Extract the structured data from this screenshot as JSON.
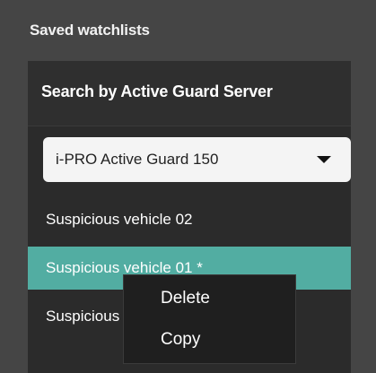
{
  "section": {
    "title": "Saved watchlists"
  },
  "panel": {
    "header_label": "Search by Active Guard Server",
    "server_select": {
      "selected_value": "i-PRO Active Guard 150"
    },
    "watchlists": [
      {
        "label": "Suspicious vehicle 02",
        "selected": false
      },
      {
        "label": "Suspicious vehicle 01 *",
        "selected": true
      },
      {
        "label": "Suspicious vehicle 03",
        "selected": false
      }
    ]
  },
  "context_menu": {
    "items": [
      {
        "label": "Delete"
      },
      {
        "label": "Copy"
      }
    ]
  },
  "colors": {
    "background": "#454545",
    "panel": "#2b2b2b",
    "selected_row": "#52ada2",
    "menu_background": "#1f1f1f"
  },
  "icons": {
    "select_chevron": "chevron-down-icon"
  }
}
